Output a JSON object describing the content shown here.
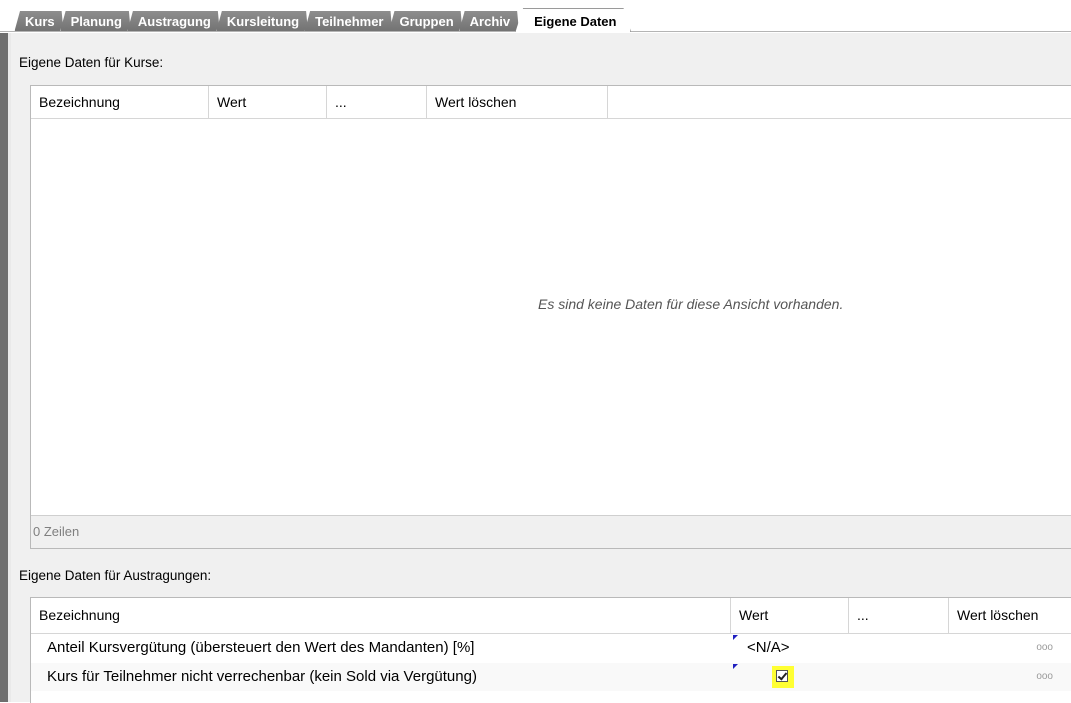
{
  "tabs": [
    {
      "label": "Kurs"
    },
    {
      "label": "Planung"
    },
    {
      "label": "Austragung"
    },
    {
      "label": "Kursleitung"
    },
    {
      "label": "Teilnehmer"
    },
    {
      "label": "Gruppen"
    },
    {
      "label": "Archiv"
    },
    {
      "label": "Eigene Daten",
      "active": true
    }
  ],
  "kurse": {
    "title": "Eigene Daten für Kurse:",
    "columns": [
      "Bezeichnung",
      "Wert",
      "...",
      "Wert löschen"
    ],
    "empty_message": "Es sind keine Daten für diese Ansicht vorhanden.",
    "row_count": "0 Zeilen"
  },
  "austragungen": {
    "title": "Eigene Daten für Austragungen:",
    "columns": [
      "Bezeichnung",
      "Wert",
      "...",
      "Wert löschen"
    ],
    "rows": [
      {
        "name": "Anteil Kursvergütung (übersteuert den Wert des Mandanten) [%]",
        "value": "<N/A>",
        "delete": "ooo"
      },
      {
        "name": "Kurs für Teilnehmer nicht verrechenbar (kein Sold via Vergütung)",
        "checked": true,
        "delete": "ooo"
      }
    ]
  },
  "colors": {
    "accent_highlight": "#ffff33",
    "tab_inactive": "#7a7a7a",
    "frame": "#6e6e6e"
  }
}
